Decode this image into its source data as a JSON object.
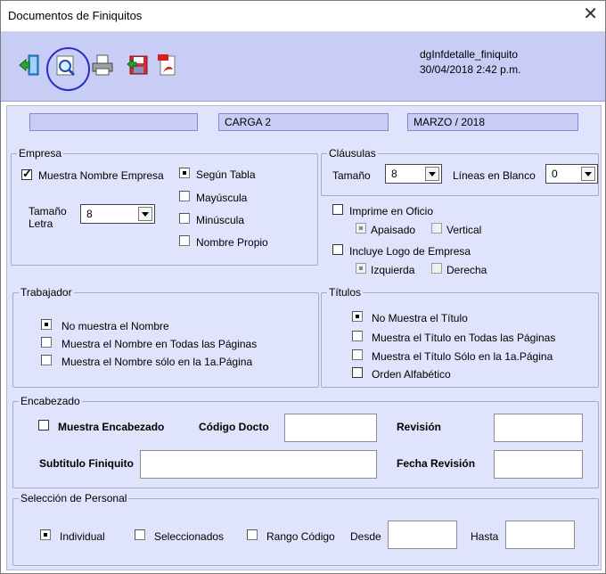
{
  "window": {
    "title": "Documentos de Finiquitos",
    "close_glyph": "✕"
  },
  "toolbar": {
    "icons": [
      "exit-icon",
      "preview-icon",
      "print-icon",
      "save-icon",
      "pdf-icon"
    ],
    "info_line1": "dgInfdetalle_finiquito",
    "info_line2": "30/04/2018 2:42 p.m."
  },
  "periods": {
    "field1": "",
    "field2": "CARGA 2",
    "field3": "MARZO / 2018"
  },
  "empresa": {
    "label": "Empresa",
    "show_name_label": "Muestra Nombre Empresa",
    "show_name_checked": true,
    "size_label_1": "Tamaño",
    "size_label_2": "Letra",
    "size_value": "8",
    "options": [
      "Según Tabla",
      "Mayúscula",
      "Minúscula",
      "Nombre Propio"
    ],
    "selected": 0
  },
  "clausulas": {
    "label": "Cláusulas",
    "size_label": "Tamaño",
    "size_value": "8",
    "blank_lines_label": "Líneas en Blanco",
    "blank_lines_value": "0"
  },
  "oficio": {
    "label": "Imprime en Oficio",
    "checked": false,
    "apaisado": "Apaisado",
    "vertical": "Vertical"
  },
  "logo": {
    "label": "Incluye Logo de Empresa",
    "checked": false,
    "izquierda": "Izquierda",
    "derecha": "Derecha"
  },
  "trabajador": {
    "label": "Trabajador",
    "options": [
      "No muestra el Nombre",
      "Muestra el Nombre en Todas las Páginas",
      "Muestra el Nombre sólo en la 1a.Página"
    ],
    "selected": 0
  },
  "titulos": {
    "label": "Títulos",
    "options": [
      "No Muestra el Título",
      "Muestra el Título en Todas las Páginas",
      "Muestra el Título Sólo en la 1a.Página"
    ],
    "selected": 0,
    "orden_label": "Orden Alfabético"
  },
  "encabezado": {
    "label": "Encabezado",
    "show_label": "Muestra Encabezado",
    "codigo_label": "Código Docto",
    "revision_label": "Revisión",
    "subtitulo_label": "Subtitulo Finiquito",
    "fecha_label": "Fecha Revisión"
  },
  "seleccion": {
    "label": "Selección de Personal",
    "options": [
      "Individual",
      "Seleccionados",
      "Rango Código"
    ],
    "selected": 0,
    "desde_label": "Desde",
    "hasta_label": "Hasta"
  }
}
